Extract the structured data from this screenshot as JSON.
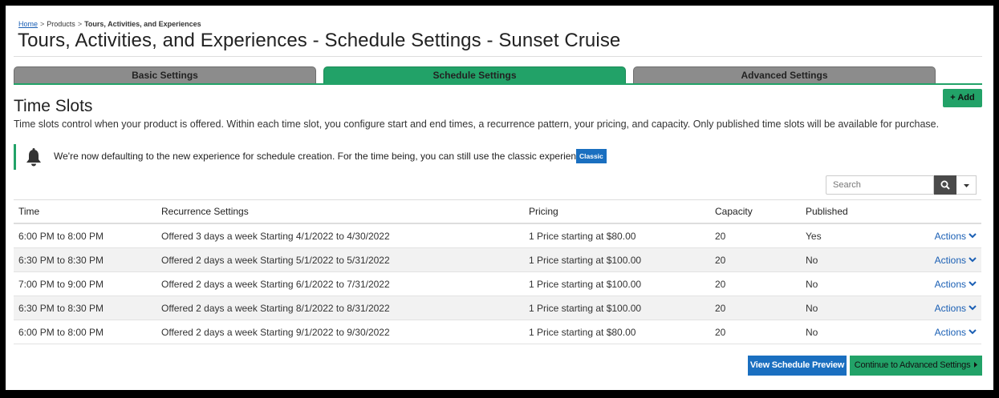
{
  "breadcrumb": {
    "home": "Home",
    "sep": ">",
    "products": "Products",
    "current": "Tours, Activities, and Experiences"
  },
  "page_title": "Tours, Activities, and Experiences - Schedule Settings - Sunset Cruise",
  "tabs": [
    {
      "label": "Basic Settings",
      "active": false
    },
    {
      "label": "Schedule Settings",
      "active": true
    },
    {
      "label": "Advanced Settings",
      "active": false
    }
  ],
  "add_button": {
    "label": "Add",
    "icon": "plus-icon"
  },
  "section": {
    "title": "Time Slots",
    "description": "Time slots control when your product is offered. Within each time slot, you configure start and end times, a recurrence pattern, your pricing, and capacity. Only published time slots will be available for purchase."
  },
  "notice": {
    "icon": "bell-icon",
    "text": "We're now defaulting to the new experience for schedule creation. For the time being, you can still use the classic experience.",
    "classic_button": "Classic"
  },
  "search": {
    "placeholder": "Search",
    "value": ""
  },
  "table": {
    "columns": [
      "Time",
      "Recurrence Settings",
      "Pricing",
      "Capacity",
      "Published",
      ""
    ],
    "rows": [
      {
        "time": "6:00 PM to 8:00 PM",
        "recurrence": "Offered 3 days a week Starting 4/1/2022 to 4/30/2022",
        "pricing": "1 Price starting at $80.00",
        "capacity": "20",
        "published": "Yes",
        "actions": "Actions"
      },
      {
        "time": "6:30 PM to 8:30 PM",
        "recurrence": "Offered 2 days a week Starting 5/1/2022 to 5/31/2022",
        "pricing": "1 Price starting at $100.00",
        "capacity": "20",
        "published": "No",
        "actions": "Actions"
      },
      {
        "time": "7:00 PM to 9:00 PM",
        "recurrence": "Offered 2 days a week Starting 6/1/2022 to 7/31/2022",
        "pricing": "1 Price starting at $100.00",
        "capacity": "20",
        "published": "No",
        "actions": "Actions"
      },
      {
        "time": "6:30 PM to 8:30 PM",
        "recurrence": "Offered 2 days a week Starting 8/1/2022 to 8/31/2022",
        "pricing": "1 Price starting at $100.00",
        "capacity": "20",
        "published": "No",
        "actions": "Actions"
      },
      {
        "time": "6:00 PM to 8:00 PM",
        "recurrence": "Offered 2 days a week Starting 9/1/2022 to 9/30/2022",
        "pricing": "1 Price starting at $80.00",
        "capacity": "20",
        "published": "No",
        "actions": "Actions"
      }
    ]
  },
  "footer": {
    "preview_button": "View Schedule Preview",
    "continue_button": "Continue to Advanced Settings"
  },
  "colors": {
    "accent_green": "#22a268",
    "link_blue": "#1a5fb4",
    "button_blue": "#1a6fc0",
    "inactive_tab": "#8c8c8c"
  }
}
